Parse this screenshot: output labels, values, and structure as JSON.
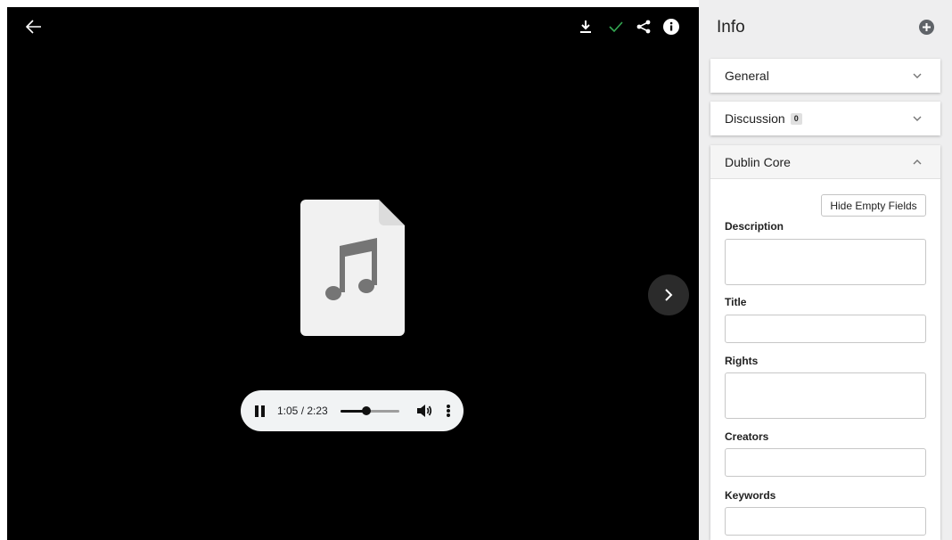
{
  "viewer": {
    "toolbar": [
      "back-arrow-icon",
      "download-icon",
      "check-icon",
      "share-icon",
      "info-icon"
    ],
    "check_color": "#34a853"
  },
  "player": {
    "time": "1:05 / 2:23",
    "progress": 0.45
  },
  "sidebar": {
    "title": "Info",
    "panels": {
      "general": "General",
      "discussion": "Discussion",
      "discussion_count": "0",
      "dublin_core": "Dublin Core"
    },
    "hide_empty_button": "Hide Empty Fields",
    "fields": {
      "description": "Description",
      "title": "Title",
      "rights": "Rights",
      "creators": "Creators",
      "keywords": "Keywords"
    }
  }
}
